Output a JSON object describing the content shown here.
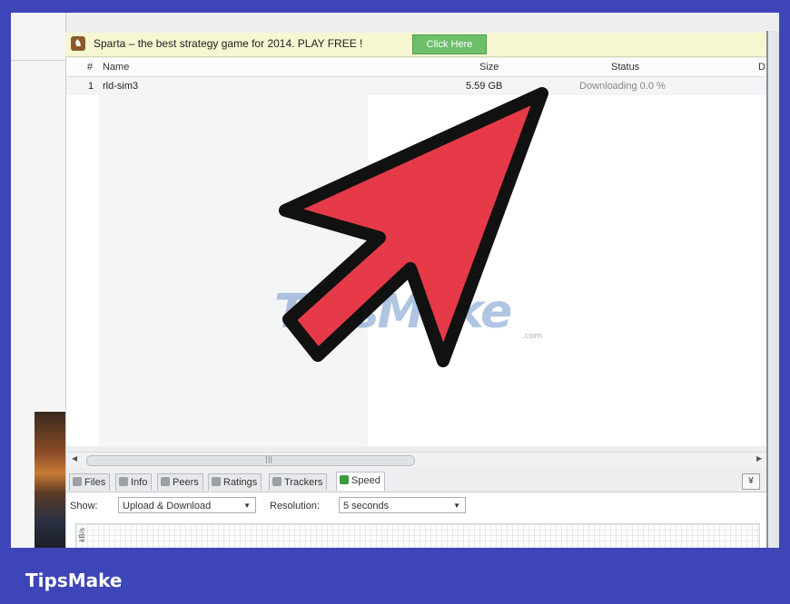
{
  "ad": {
    "text": "Sparta – the best strategy game for 2014. PLAY FREE !",
    "button": "Click Here"
  },
  "table": {
    "columns": [
      "#",
      "Name",
      "Size",
      "Status",
      "D"
    ],
    "rows": [
      {
        "num": "1",
        "name": "rld-sim3",
        "size": "5.59 GB",
        "status": "Downloading 0.0 %"
      }
    ]
  },
  "tabs": [
    "Files",
    "Info",
    "Peers",
    "Ratings",
    "Trackers",
    "Speed"
  ],
  "speed": {
    "show_label": "Show:",
    "show_value": "Upload & Download",
    "resolution_label": "Resolution:",
    "resolution_value": "5 seconds",
    "graph_axis": "kB/s"
  },
  "watermark": {
    "main": "TipsMake",
    "suffix": ".com"
  },
  "brand": "TipsMake",
  "colors": {
    "frame": "#3d45b8",
    "arrow": "#e63a48",
    "ad_button": "#6dbf6a"
  }
}
